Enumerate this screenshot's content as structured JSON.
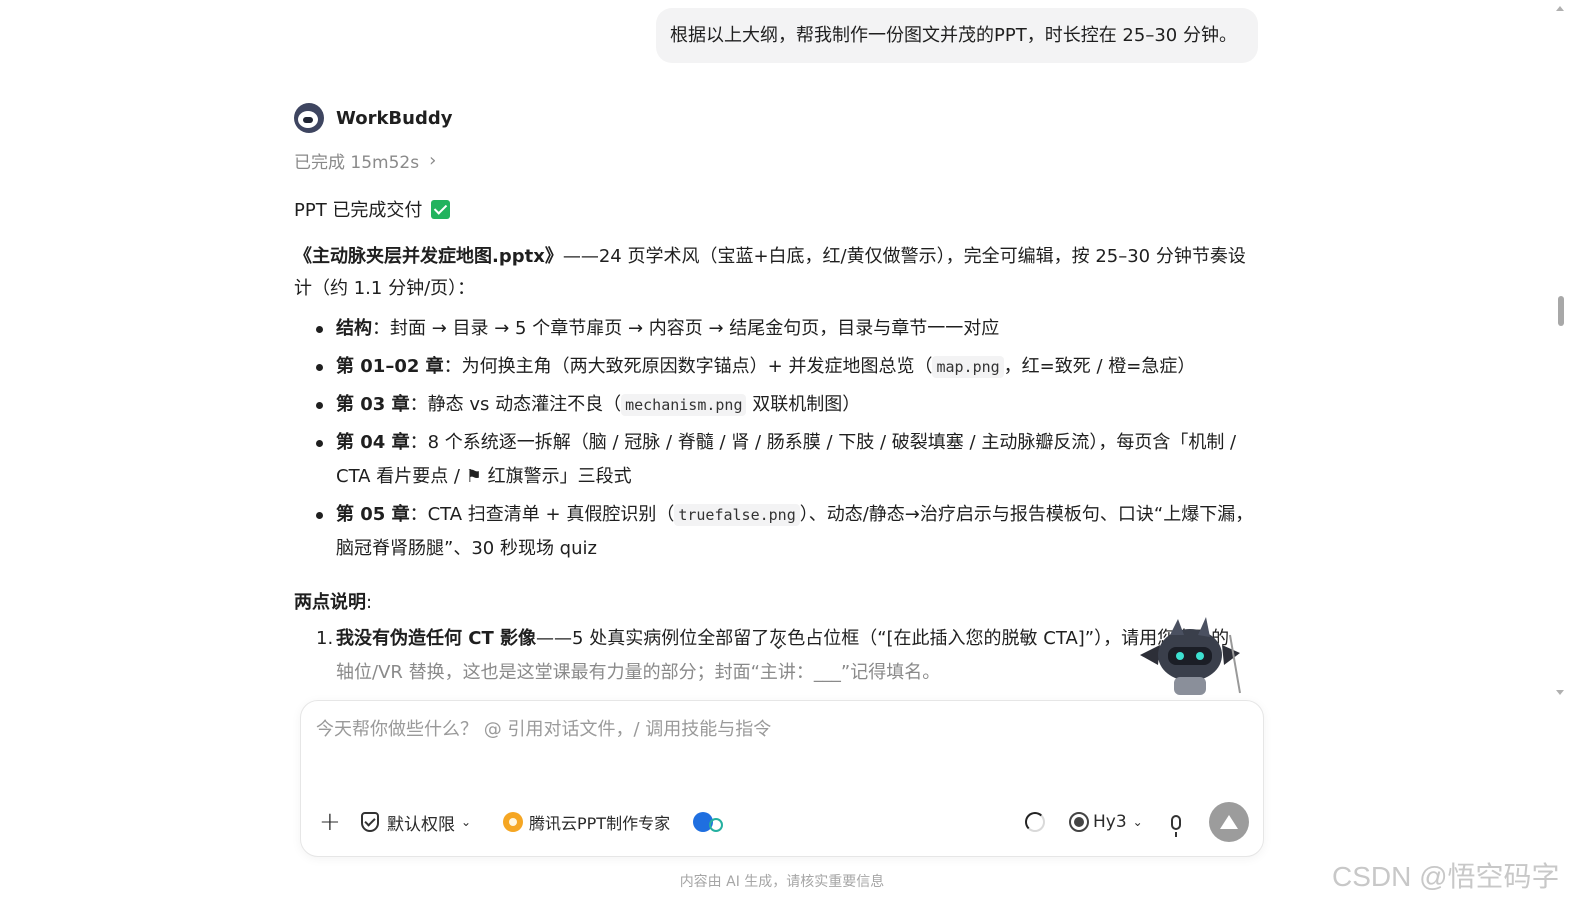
{
  "user_message": "根据以上大纲，帮我制作一份图文并茂的PPT，时长控在 25–30 分钟。",
  "assistant": {
    "name": "WorkBuddy",
    "status": "已完成 15m52s",
    "done_text": "PPT 已完成交付",
    "summary": {
      "file_title": "《主动脉夹层并发症地图.pptx》",
      "text": "——24 页学术风（宝蓝+白底，红/黄仅做警示），完全可编辑，按 25–30 分钟节奏设计（约 1.1 分钟/页）："
    },
    "bullets": [
      {
        "label": "结构",
        "text": "：封面 → 目录 → 5 个章节扉页 → 内容页 → 结尾金句页，目录与章节一一对应"
      },
      {
        "label": "第 01–02 章",
        "pre": "：为何换主角（两大致死原因数字锚点）+ 并发症地图总览（",
        "code": "map.png",
        "post": "，红=致死 / 橙=急症）"
      },
      {
        "label": "第 03 章",
        "pre": "：静态 vs 动态灌注不良（",
        "code": "mechanism.png",
        "post": " 双联机制图）"
      },
      {
        "label": "第 04 章",
        "text": "：8 个系统逐一拆解（脑 / 冠脉 / 脊髓 / 肾 / 肠系膜 / 下肢 / 破裂填塞 / 主动脉瓣反流），每页含「机制 / CTA 看片要点 / ⚑ 红旗警示」三段式"
      },
      {
        "label": "第 05 章",
        "pre": "：CTA 扫查清单 + 真假腔识别（",
        "code": "truefalse.png",
        "post": "）、动态/静态→治疗启示与报告模板句、口诀“上爆下漏，脑冠脊肾肠腿”、30 秒现场 quiz"
      }
    ],
    "notes_title": "两点说明",
    "notes": [
      {
        "num": "1.",
        "label": "我没有伪造任何 CT 影像",
        "text": "——5 处真实病例位全部留了灰色占位框（“[在此插入您的脱敏 CTA]”），请用您自己的",
        "text2": "轴位/VR 替换，这也是这堂课最有力量的部分；封面“主讲：___”记得填名。"
      }
    ]
  },
  "composer": {
    "placeholder": "今天帮你做些什么？ @ 引用对话文件，/ 调用技能与指令",
    "permission": "默认权限",
    "skill": "腾讯云PPT制作专家",
    "model": "Hy3"
  },
  "footer_note": "内容由 AI 生成，请核实重要信息",
  "watermark": "CSDN @悟空码字"
}
